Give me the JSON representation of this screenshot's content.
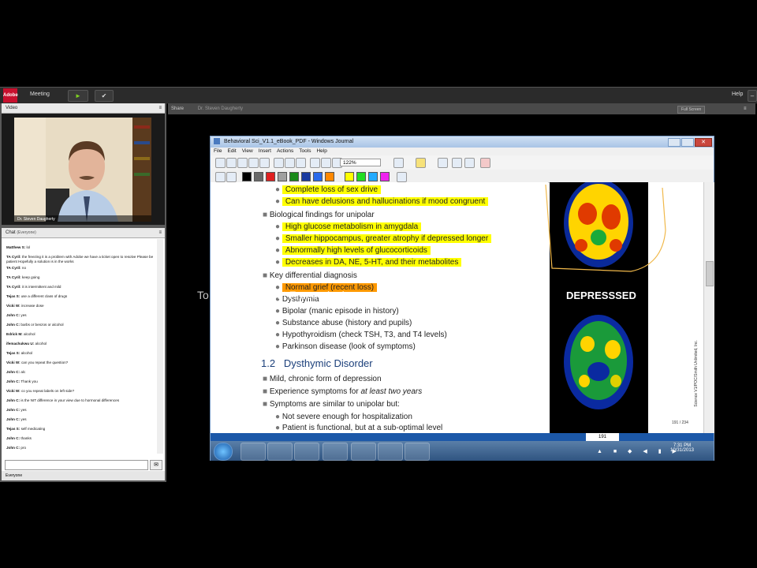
{
  "topbar": {
    "logo": "Adobe",
    "meeting_label": "Meeting",
    "help_label": "Help"
  },
  "video_pod": {
    "title": "Video",
    "caption": "Dr. Steven Daugherty"
  },
  "chat_pod": {
    "title": "Chat",
    "scope": "(Everyone)",
    "messages": [
      {
        "from": "Matthew S:",
        "text": "lol"
      },
      {
        "from": "TA Cyril:",
        "text": "the freezing it is a problem with Adobe we have a ticket open to resolve Please be patient Hopefully a solution is in the works"
      },
      {
        "from": "TA Cyril:",
        "text": "no"
      },
      {
        "from": "TA Cyril:",
        "text": "keep going"
      },
      {
        "from": "TA Cyril:",
        "text": "it is intermittent and mild"
      },
      {
        "from": "Tejas S:",
        "text": "use a different class of drugs"
      },
      {
        "from": "Vicki W:",
        "text": "increase dose"
      },
      {
        "from": "John C:",
        "text": "yes"
      },
      {
        "from": "John C:",
        "text": "barbs or benzos or alcohol"
      },
      {
        "from": "Edrick M:",
        "text": "alcohol"
      },
      {
        "from": "ifemachukwu U:",
        "text": "alcohol"
      },
      {
        "from": "Tejas S:",
        "text": "alcohol"
      },
      {
        "from": "Vicki W:",
        "text": "can you repeat the question?"
      },
      {
        "from": "John C:",
        "text": "alc"
      },
      {
        "from": "John C:",
        "text": "Thank you"
      },
      {
        "from": "Vicki W:",
        "text": "co you repeat labels on left side?"
      },
      {
        "from": "John C:",
        "text": "is the NIT difference in your view due to hormonal differences"
      },
      {
        "from": "John C:",
        "text": "yes"
      },
      {
        "from": "John C:",
        "text": "yes"
      },
      {
        "from": "Tejas S:",
        "text": "self medicating"
      },
      {
        "from": "John C:",
        "text": "thanks"
      },
      {
        "from": "John C:",
        "text": "pro"
      }
    ],
    "footer_tab": "Everyone"
  },
  "share_pod": {
    "title": "Share",
    "presenter": "Dr. Steven Daugherty",
    "fullscreen_label": "Full Screen"
  },
  "journal": {
    "title": "Behavioral Sci_V1.1_eBook_PDF - Windows Journal",
    "menu": [
      "File",
      "Edit",
      "View",
      "Insert",
      "Actions",
      "Tools",
      "Help"
    ],
    "zoom": "122%",
    "lines": [
      {
        "t": "Complete loss of sex drive",
        "level": 2,
        "hl": "yellow"
      },
      {
        "t": "Can have delusions and hallucinations if mood congruent",
        "level": 2,
        "hl": "yellow"
      },
      {
        "t": "Biological findings for unipolar",
        "level": 1,
        "hl": ""
      },
      {
        "t": "High glucose metabolism in amygdala",
        "level": 2,
        "hl": "yellow"
      },
      {
        "t": "Smaller hippocampus, greater atrophy if depressed longer",
        "level": 2,
        "hl": "yellow"
      },
      {
        "t": "Abnormally high levels of glucocorticoids",
        "level": 2,
        "hl": "yellow"
      },
      {
        "t": "Decreases in DA, NE, 5-HT, and their metabolites",
        "level": 2,
        "hl": "yellow"
      },
      {
        "t": "Key differential diagnosis",
        "level": 1,
        "hl": ""
      },
      {
        "t": "Normal grief (recent loss)",
        "level": 2,
        "hl": "orange"
      },
      {
        "t": "Dysthymia",
        "level": 2,
        "hl": ""
      },
      {
        "t": "Bipolar (manic episode in history)",
        "level": 2,
        "hl": ""
      },
      {
        "t": "Substance abuse (history and pupils)",
        "level": 2,
        "hl": ""
      },
      {
        "t": "Hypothyroidism (check TSH, T3, and T4 levels)",
        "level": 2,
        "hl": ""
      },
      {
        "t": "Parkinson disease (look of symptoms)",
        "level": 2,
        "hl": ""
      }
    ],
    "section_num": "1.2",
    "section_title": "Dysthymic Disorder",
    "lines2_a": "Mild, chronic form of depression",
    "lines2_b_pre": "Experience symptoms for ",
    "lines2_b_em": "at least two years",
    "lines2_c": "Symptoms are similar to unipolar but:",
    "lines2_d": "Not severe enough for hospitalization",
    "lines2_e": "Patient is functional, but at a sub-optimal level",
    "image_label": "DEPRESSSED",
    "side_credit": "Science V1/POC/Smith Unlimited, Inc.",
    "page_counter": "191 / 234",
    "page_box": "191",
    "clock_time": "7:31 PM",
    "clock_date": "10/31/2013"
  },
  "watermark": "To convert without Freemake logo, use Freemake Gold Pack"
}
